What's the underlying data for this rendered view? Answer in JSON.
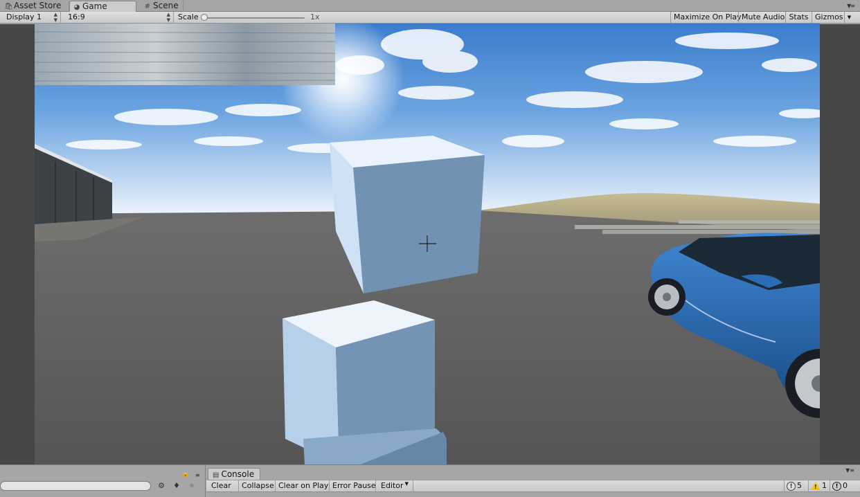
{
  "tabs": [
    {
      "label": "Asset Store",
      "icon": "shopping-bag-icon"
    },
    {
      "label": "Game",
      "icon": "pacman-icon"
    },
    {
      "label": "Scene",
      "icon": "grid-icon"
    }
  ],
  "toolbar": {
    "display": "Display 1",
    "aspect": "16:9",
    "scale_label": "Scale",
    "scale_value": "1x",
    "scale_fraction": 0.0,
    "maximize_on_play": "Maximize On Play",
    "mute_audio": "Mute Audio",
    "stats": "Stats",
    "gizmos": "Gizmos"
  },
  "console": {
    "tab_label": "Console",
    "clear": "Clear",
    "collapse": "Collapse",
    "clear_on_play": "Clear on Play",
    "error_pause": "Error Pause",
    "editor": "Editor",
    "info_count": "5",
    "warning_count": "1",
    "error_count": "0"
  },
  "colors": {
    "sky_top": "#3a7fd0",
    "sky_horizon": "#e8f1fb",
    "ground": "#5f5f5f",
    "cube": "#6f8fb0",
    "car": "#1f5fa8",
    "editor_bg": "#a6a6a6",
    "viewport_bg": "#474747"
  }
}
